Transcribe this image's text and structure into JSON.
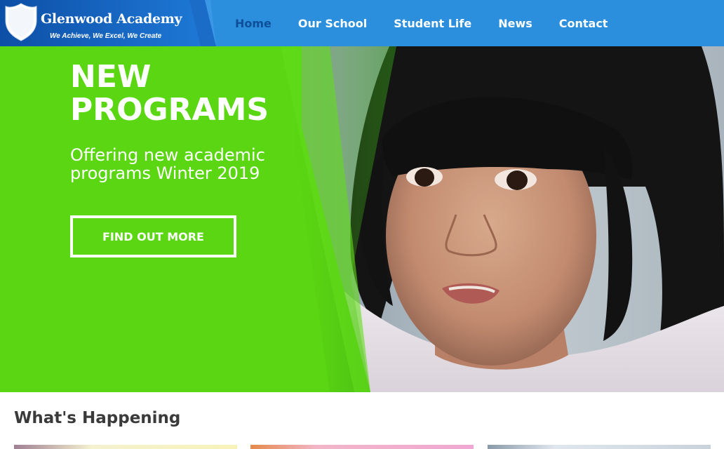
{
  "brand": {
    "name": "Glenwood Academy",
    "tagline": "We Achieve, We Excel, We Create",
    "icon": "shield-icon"
  },
  "nav": {
    "items": [
      {
        "label": "Home",
        "active": true
      },
      {
        "label": "Our School",
        "active": false
      },
      {
        "label": "Student Life",
        "active": false
      },
      {
        "label": "News",
        "active": false
      },
      {
        "label": "Contact",
        "active": false
      }
    ]
  },
  "hero": {
    "title": "NEW\nPROGRAMS",
    "subtitle": "Offering new academic programs Winter 2019",
    "button_label": "FIND OUT MORE"
  },
  "section": {
    "title": "What's Happening"
  },
  "colors": {
    "nav_bg": "#2b8fdd",
    "logo_bg": "#1565c0",
    "hero_green": "#5ad612",
    "active_nav": "#0e4f9a"
  }
}
